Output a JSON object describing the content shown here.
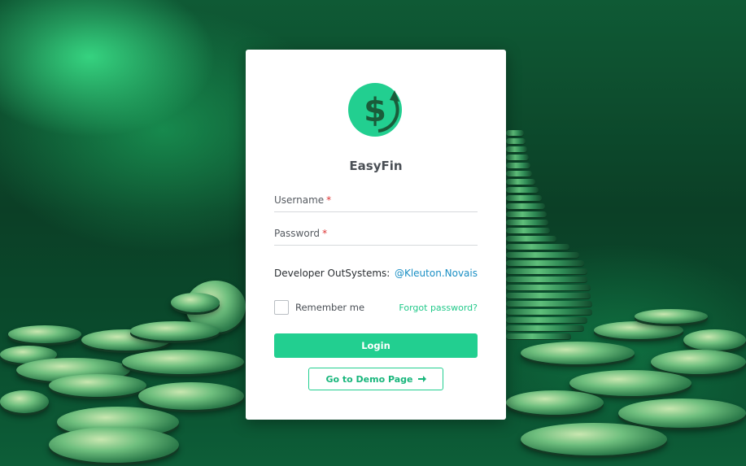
{
  "app": {
    "name": "EasyFin",
    "logo_icon": "dollar-refresh-icon",
    "accent": "#22cf90"
  },
  "form": {
    "username_label": "Username",
    "password_label": "Password",
    "required_marker": "*",
    "username_value": "",
    "password_value": ""
  },
  "developer": {
    "label": "Developer OutSystems:",
    "handle": "@Kleuton.Novais"
  },
  "options": {
    "remember_label": "Remember me",
    "forgot_label": "Forgot password?"
  },
  "actions": {
    "login_label": "Login",
    "demo_label": "Go to Demo Page",
    "demo_icon": "arrow-right-icon"
  }
}
